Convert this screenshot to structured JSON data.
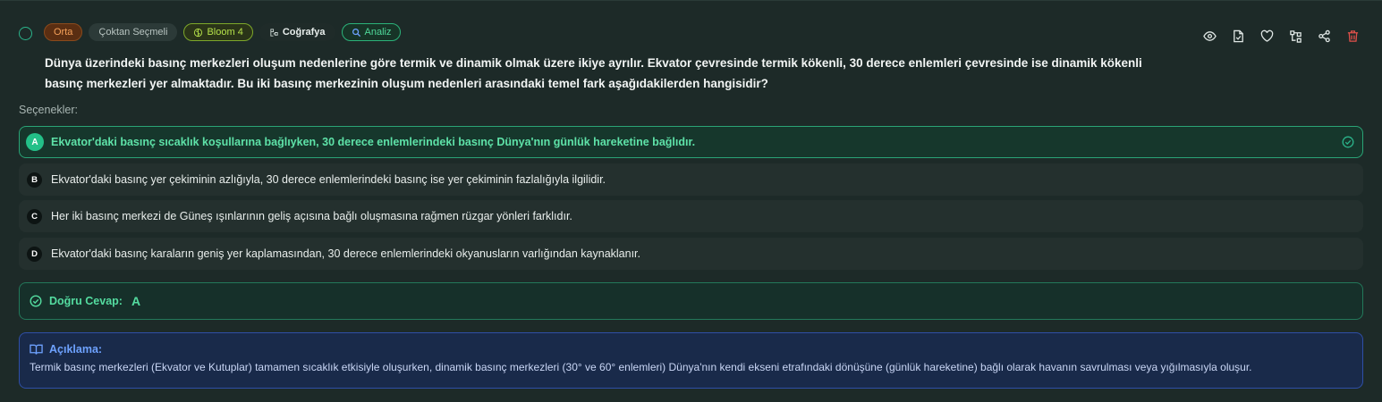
{
  "badges": {
    "difficulty": "Orta",
    "type": "Çoktan Seçmeli",
    "bloom": "Bloom 4",
    "subject": "Coğrafya",
    "skill": "Analiz"
  },
  "question": "Dünya üzerindeki basınç merkezleri oluşum nedenlerine göre termik ve dinamik olmak üzere ikiye ayrılır. Ekvator çevresinde termik kökenli, 30 derece enlemleri çevresinde ise dinamik kökenli basınç merkezleri yer almaktadır. Bu iki basınç merkezinin oluşum nedenleri arasındaki temel fark aşağıdakilerden hangisidir?",
  "options_label": "Seçenekler:",
  "options": [
    {
      "letter": "A",
      "text": "Ekvator'daki basınç sıcaklık koşullarına bağlıyken, 30 derece enlemlerindeki basınç Dünya'nın günlük hareketine bağlıdır.",
      "correct": true
    },
    {
      "letter": "B",
      "text": "Ekvator'daki basınç yer çekiminin azlığıyla, 30 derece enlemlerindeki basınç ise yer çekiminin fazlalığıyla ilgilidir.",
      "correct": false
    },
    {
      "letter": "C",
      "text": "Her iki basınç merkezi de Güneş ışınlarının geliş açısına bağlı oluşmasına rağmen rüzgar yönleri farklıdır.",
      "correct": false
    },
    {
      "letter": "D",
      "text": "Ekvator'daki basınç karaların geniş yer kaplamasından, 30 derece enlemlerindeki okyanusların varlığından kaynaklanır.",
      "correct": false
    }
  ],
  "answer": {
    "label": "Doğru Cevap:",
    "value": "A"
  },
  "explanation": {
    "title": "Açıklama:",
    "text": "Termik basınç merkezleri (Ekvator ve Kutuplar) tamamen sıcaklık etkisiyle oluşurken, dinamik basınç merkezleri (30° ve 60° enlemleri) Dünya'nın kendi ekseni etrafındaki dönüşüne (günlük hareketine) bağlı olarak havanın savrulması veya yığılmasıyla oluşur."
  },
  "icons": [
    "eye-icon",
    "file-check-icon",
    "heart-icon",
    "tree-icon",
    "share-icon",
    "trash-icon"
  ],
  "colors": {
    "accent": "#2bb38a",
    "correct": "#23c088",
    "danger": "#e0504a",
    "info": "#6ea2ff"
  }
}
